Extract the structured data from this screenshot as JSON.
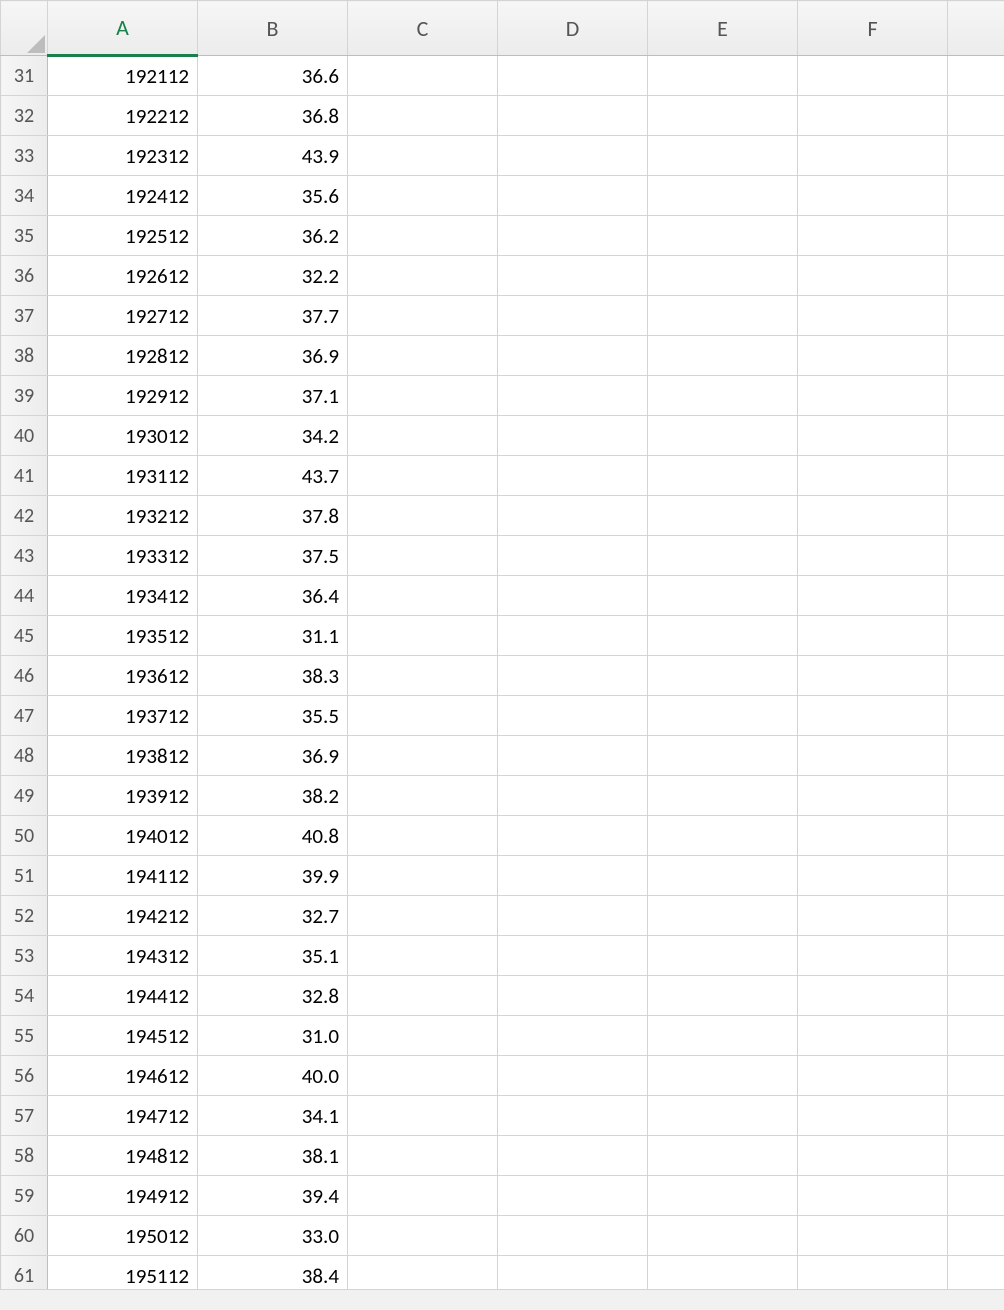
{
  "columns": {
    "corner": "",
    "A": "A",
    "B": "B",
    "C": "C",
    "D": "D",
    "E": "E",
    "F": "F"
  },
  "rows": [
    {
      "n": "31",
      "A": "192112",
      "B": "36.6"
    },
    {
      "n": "32",
      "A": "192212",
      "B": "36.8"
    },
    {
      "n": "33",
      "A": "192312",
      "B": "43.9"
    },
    {
      "n": "34",
      "A": "192412",
      "B": "35.6"
    },
    {
      "n": "35",
      "A": "192512",
      "B": "36.2"
    },
    {
      "n": "36",
      "A": "192612",
      "B": "32.2"
    },
    {
      "n": "37",
      "A": "192712",
      "B": "37.7"
    },
    {
      "n": "38",
      "A": "192812",
      "B": "36.9"
    },
    {
      "n": "39",
      "A": "192912",
      "B": "37.1"
    },
    {
      "n": "40",
      "A": "193012",
      "B": "34.2"
    },
    {
      "n": "41",
      "A": "193112",
      "B": "43.7"
    },
    {
      "n": "42",
      "A": "193212",
      "B": "37.8"
    },
    {
      "n": "43",
      "A": "193312",
      "B": "37.5"
    },
    {
      "n": "44",
      "A": "193412",
      "B": "36.4"
    },
    {
      "n": "45",
      "A": "193512",
      "B": "31.1"
    },
    {
      "n": "46",
      "A": "193612",
      "B": "38.3"
    },
    {
      "n": "47",
      "A": "193712",
      "B": "35.5"
    },
    {
      "n": "48",
      "A": "193812",
      "B": "36.9"
    },
    {
      "n": "49",
      "A": "193912",
      "B": "38.2"
    },
    {
      "n": "50",
      "A": "194012",
      "B": "40.8"
    },
    {
      "n": "51",
      "A": "194112",
      "B": "39.9"
    },
    {
      "n": "52",
      "A": "194212",
      "B": "32.7"
    },
    {
      "n": "53",
      "A": "194312",
      "B": "35.1"
    },
    {
      "n": "54",
      "A": "194412",
      "B": "32.8"
    },
    {
      "n": "55",
      "A": "194512",
      "B": "31.0"
    },
    {
      "n": "56",
      "A": "194612",
      "B": "40.0"
    },
    {
      "n": "57",
      "A": "194712",
      "B": "34.1"
    },
    {
      "n": "58",
      "A": "194812",
      "B": "38.1"
    },
    {
      "n": "59",
      "A": "194912",
      "B": "39.4"
    },
    {
      "n": "60",
      "A": "195012",
      "B": "33.0"
    },
    {
      "n": "61",
      "A": "195112",
      "B": "38.4"
    }
  ]
}
